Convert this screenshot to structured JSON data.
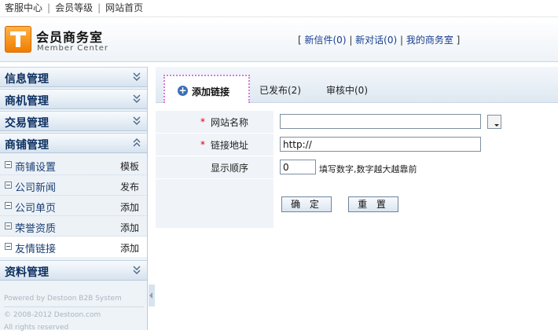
{
  "toplinks": [
    "客服中心",
    "会员等级",
    "网站首页"
  ],
  "header": {
    "title": "会员商务室",
    "subtitle": "Member Center",
    "links": [
      {
        "label": "新信件(0)"
      },
      {
        "label": "新对话(0)"
      },
      {
        "label": "我的商务室"
      }
    ]
  },
  "sidebar": {
    "groups": {
      "info": "信息管理",
      "biz": "商机管理",
      "trade": "交易管理",
      "shop": "商铺管理",
      "profile": "资料管理"
    },
    "items": [
      {
        "name": "商铺设置",
        "action": "模板"
      },
      {
        "name": "公司新闻",
        "action": "发布"
      },
      {
        "name": "公司单页",
        "action": "添加"
      },
      {
        "name": "荣誉资质",
        "action": "添加"
      },
      {
        "name": "友情链接",
        "action": "添加"
      }
    ],
    "footer": {
      "line1": "Powered by Destoon B2B System",
      "line2": "© 2008-2012 Destoon.com",
      "line3": "All rights reserved"
    }
  },
  "tabs": {
    "active": "添加链接",
    "published": "已发布(2)",
    "pending": "审核中(0)"
  },
  "form": {
    "site_name_label": "网站名称",
    "site_name_value": "",
    "link_url_label": "链接地址",
    "link_url_value": "http://",
    "order_label": "显示顺序",
    "order_value": "0",
    "order_hint": "填写数字,数字越大越靠前",
    "required_mark": "*"
  },
  "buttons": {
    "confirm": "确 定",
    "reset": "重 置"
  }
}
